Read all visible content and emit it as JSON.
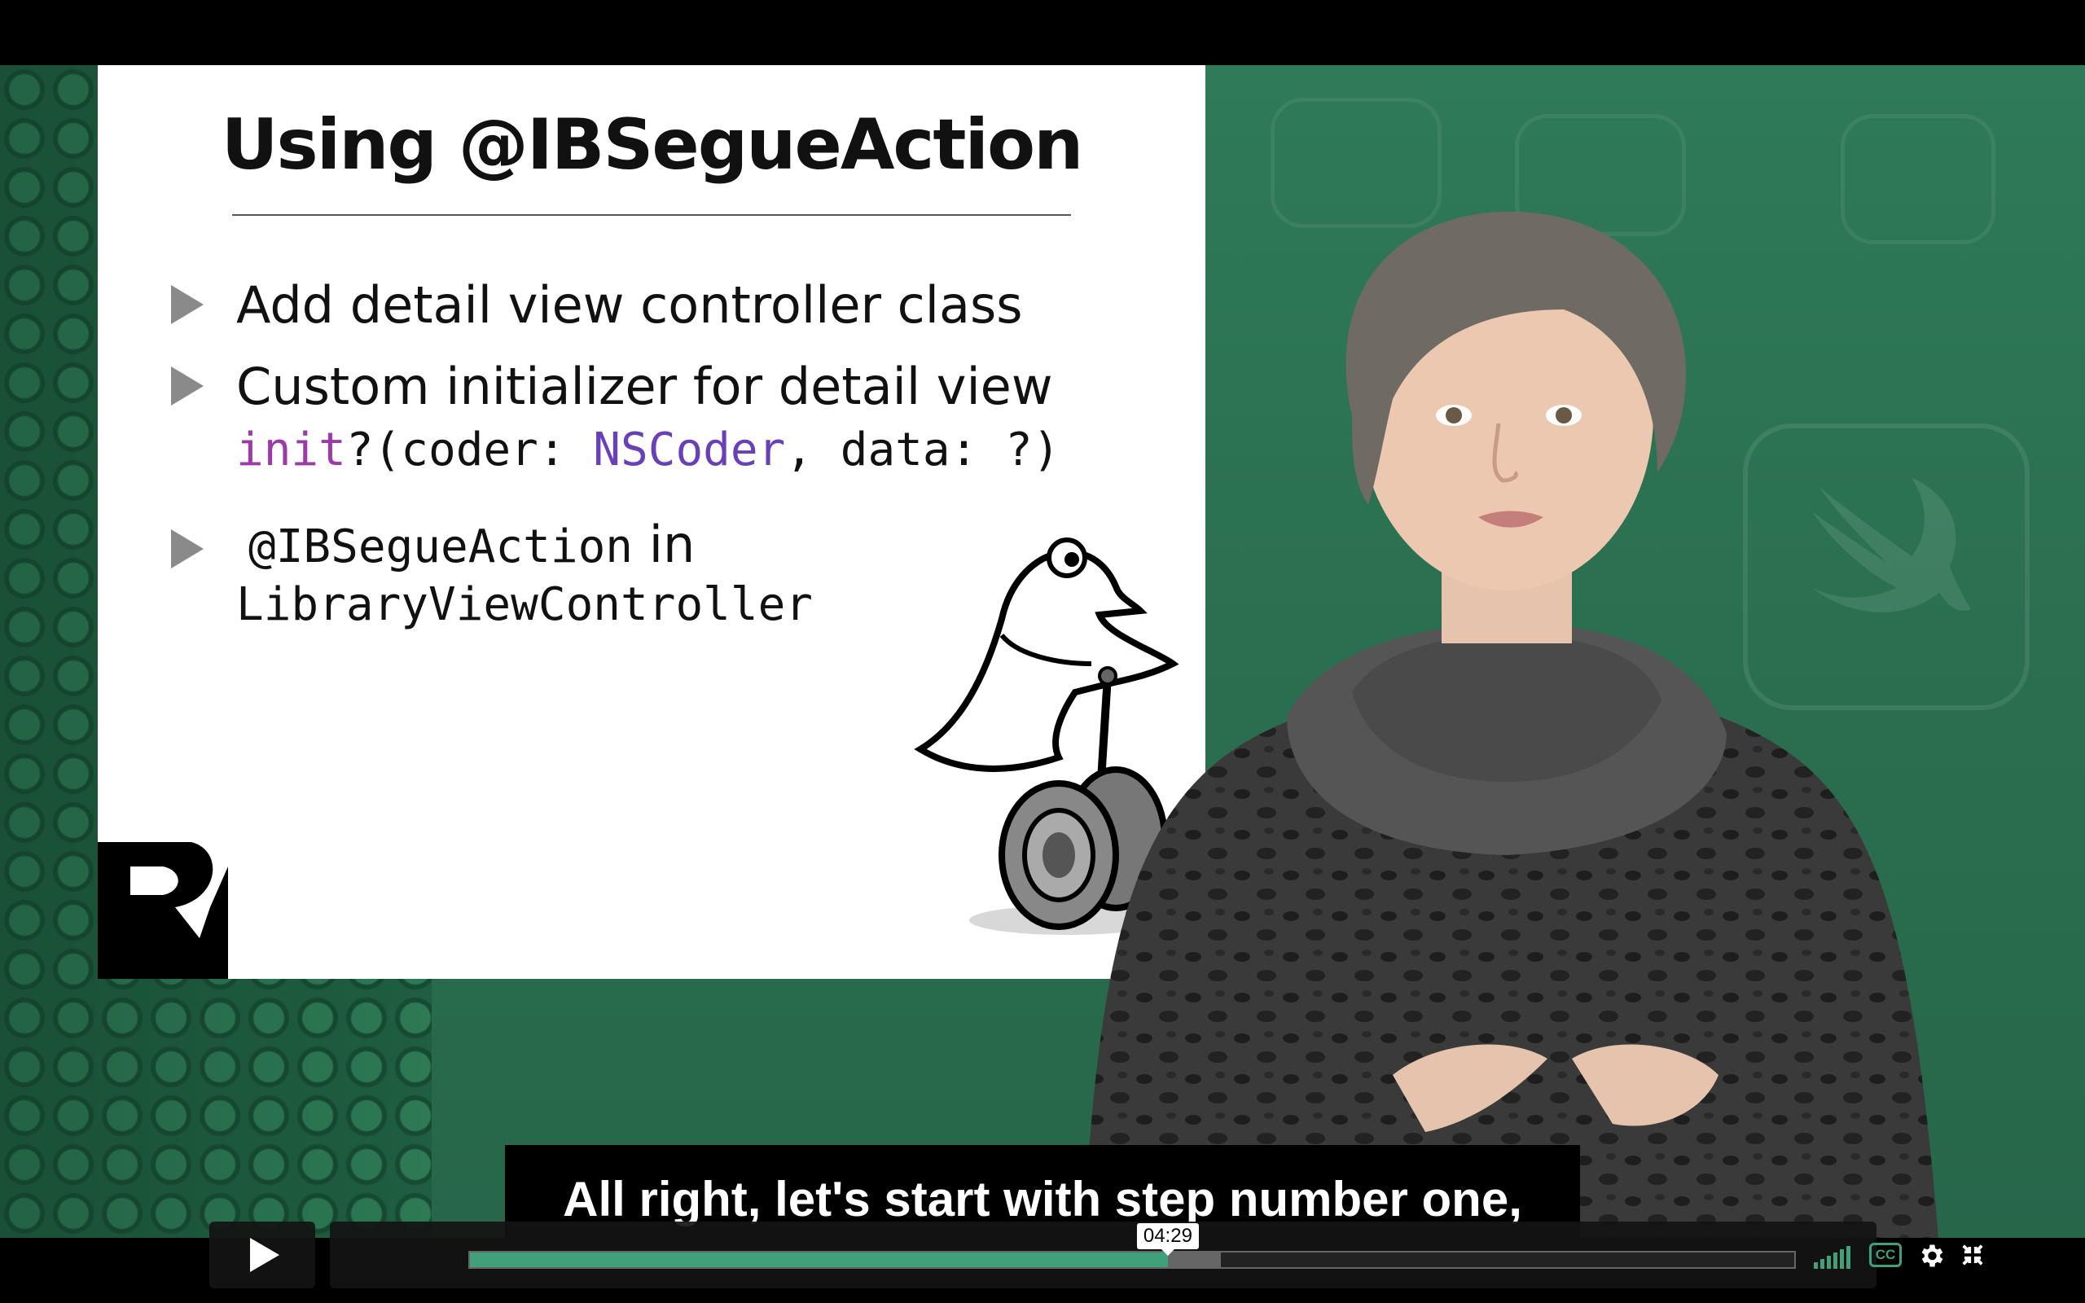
{
  "slide": {
    "title": "Using @IBSegueAction",
    "bullet1": "Add detail view controller class",
    "bullet2": "Custom initializer for detail view",
    "code_init": "init",
    "code_part1": "?(coder: ",
    "code_type": "NSCoder",
    "code_part2": ", data: ?)",
    "bullet3_code": "@IBSegueAction",
    "bullet3_in": "in",
    "bullet3_code2": "LibraryViewController"
  },
  "subtitle": "All right, let's start with step number one,",
  "player": {
    "time_tooltip": "04:29",
    "played_fraction": 0.527,
    "loaded_fraction": 0.567,
    "cc_label": "CC",
    "accent_color": "#3fa07a"
  },
  "icons": {
    "play": "play-icon",
    "volume": "volume-icon",
    "captions": "closed-captions-icon",
    "settings": "gear-icon",
    "fullscreen": "collapse-fullscreen-icon"
  }
}
